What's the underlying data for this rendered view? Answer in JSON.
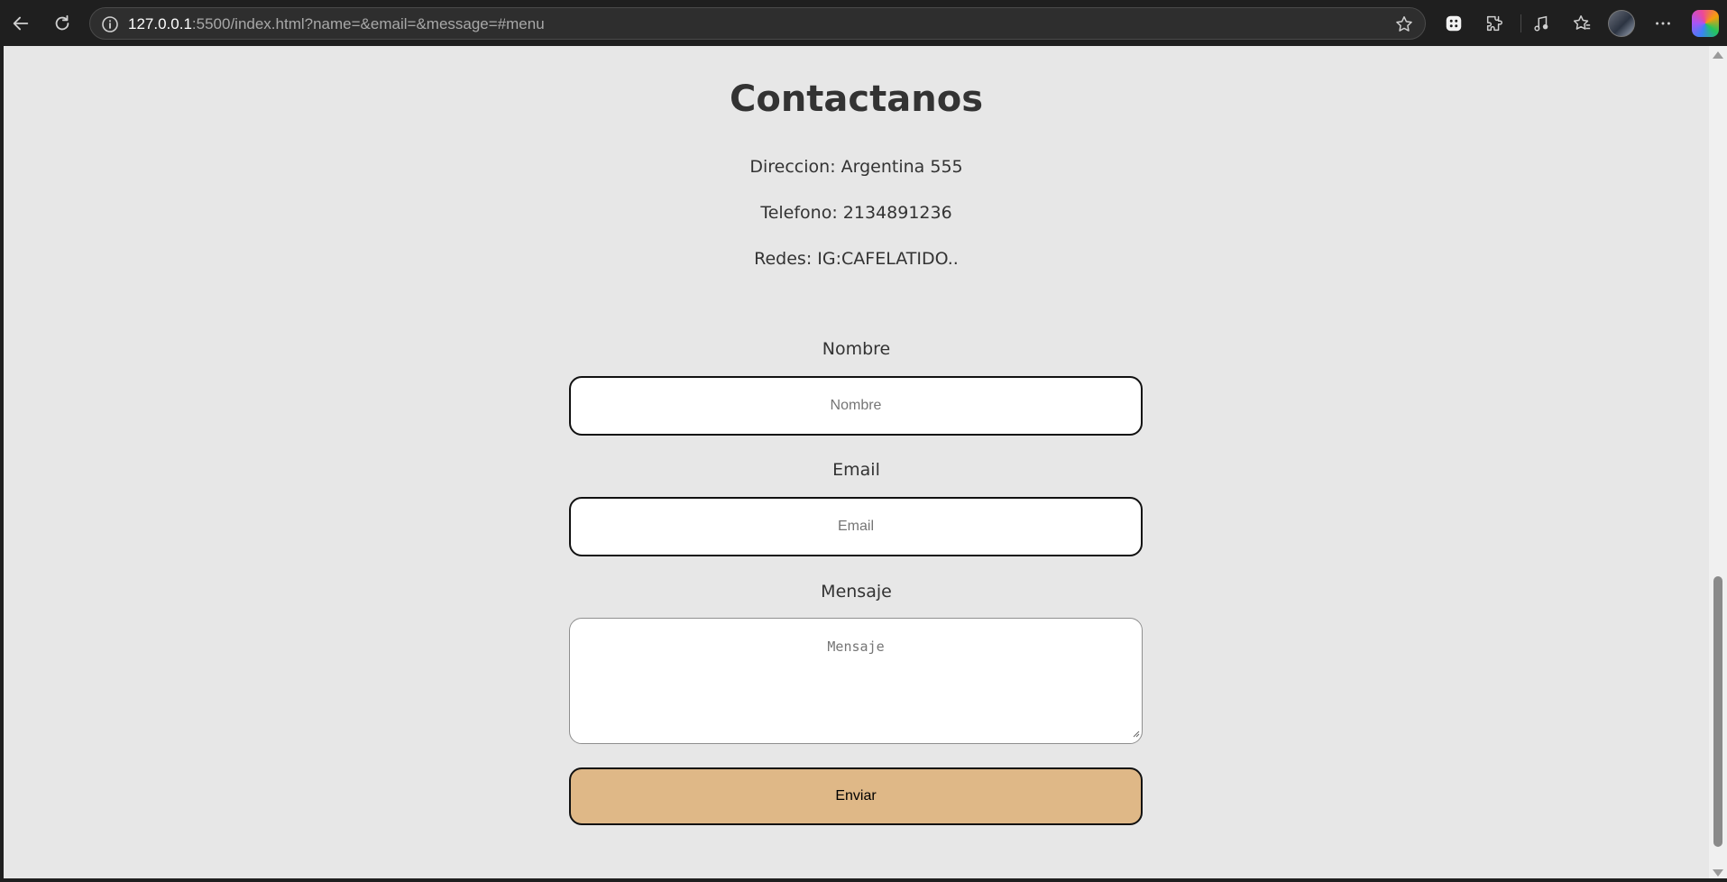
{
  "browser": {
    "url_host": "127.0.0.1",
    "url_rest": ":5500/index.html?name=&email=&message=#menu"
  },
  "contact": {
    "title": "Contactanos",
    "address": "Direccion: Argentina 555",
    "phone": "Telefono: 2134891236",
    "social": "Redes: IG:CAFELATIDO.."
  },
  "form": {
    "name_label": "Nombre",
    "name_placeholder": "Nombre",
    "name_value": "",
    "email_label": "Email",
    "email_placeholder": "Email",
    "email_value": "",
    "message_label": "Mensaje",
    "message_placeholder": "Mensaje",
    "message_value": "",
    "submit_label": "Enviar"
  },
  "colors": {
    "page_bg": "#e7e7e7",
    "button_bg": "#dfb887",
    "text": "#333333"
  }
}
